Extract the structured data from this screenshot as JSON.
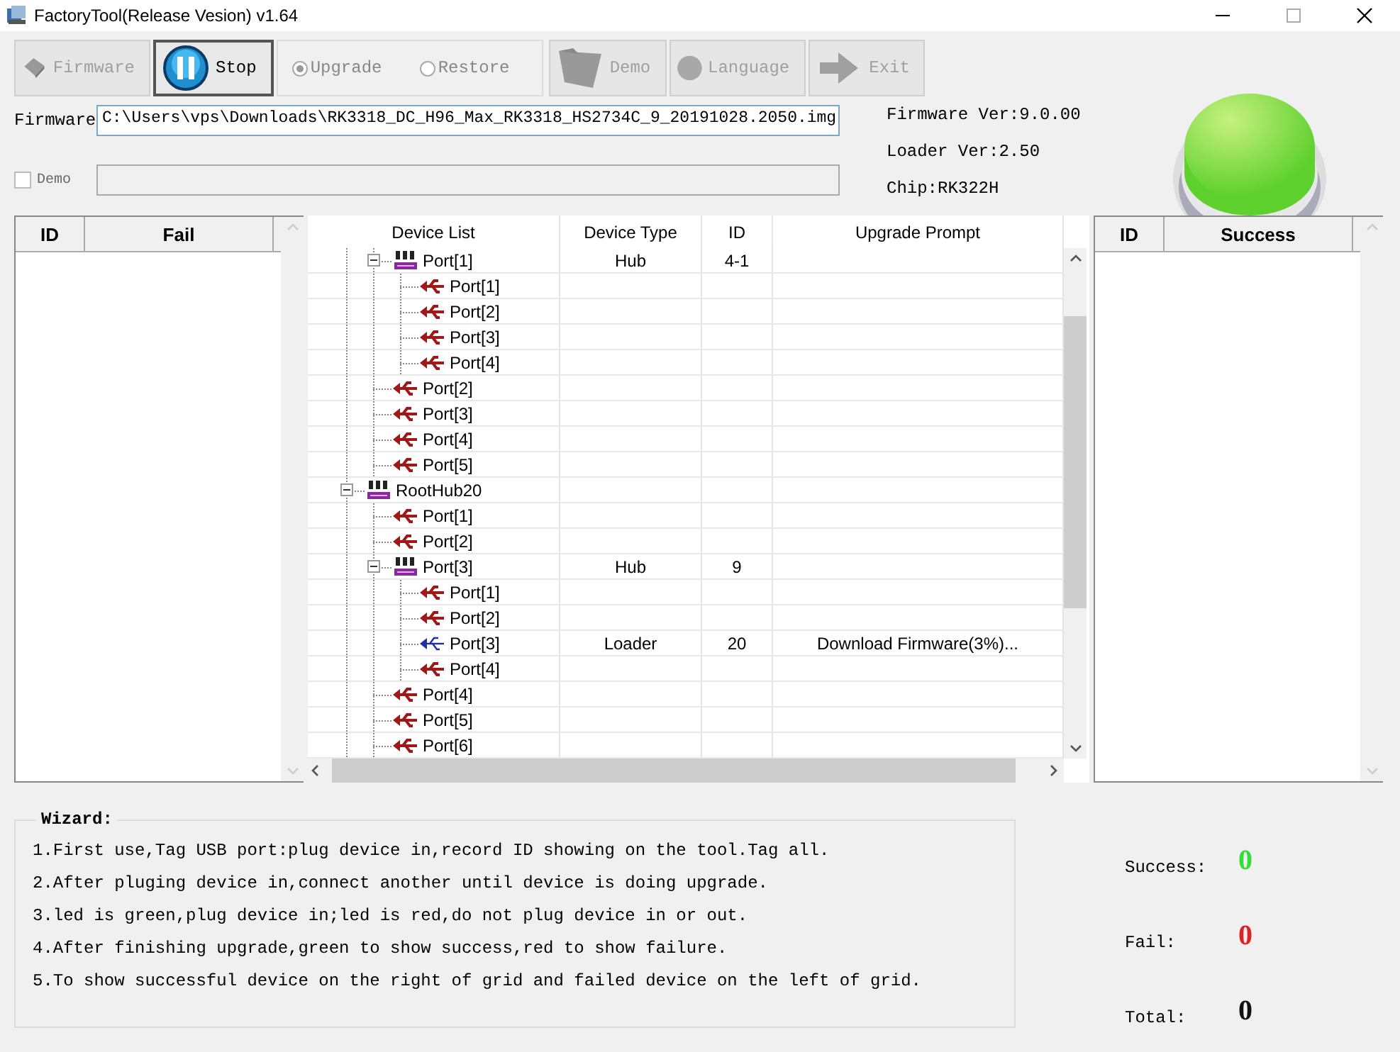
{
  "window": {
    "title": "FactoryTool(Release Vesion) v1.64"
  },
  "toolbar": {
    "buttons": [
      {
        "kind": "firmware",
        "label": "Firmware",
        "disabled": true,
        "pressed": false
      },
      {
        "kind": "stop",
        "label": "Stop",
        "disabled": false,
        "pressed": true
      }
    ],
    "radios": [
      {
        "label": "Upgrade",
        "selected": true,
        "disabled": true
      },
      {
        "label": "Restore",
        "selected": false,
        "disabled": true
      }
    ],
    "buttons_after": [
      {
        "kind": "demo",
        "label": "Demo",
        "disabled": true,
        "pressed": false
      },
      {
        "kind": "language",
        "label": "Language",
        "disabled": true,
        "pressed": false
      },
      {
        "kind": "exit",
        "label": "Exit",
        "disabled": true,
        "pressed": false
      }
    ]
  },
  "firmware": {
    "label": "Firmware",
    "value": "C:\\Users\\vps\\Downloads\\RK3318_DC_H96_Max_RK3318_HS2734C_9_20191028.2050.img"
  },
  "demo": {
    "label": "Demo",
    "checked": false
  },
  "info": [
    "Firmware Ver:9.0.00",
    "Loader Ver:2.50",
    "Chip:RK322H"
  ],
  "led": {
    "color": "#5fd12e"
  },
  "fail_list": {
    "columns": [
      "ID",
      "Fail"
    ]
  },
  "device_grid": {
    "columns": [
      "Device List",
      "Device Type",
      "ID",
      "Upgrade Prompt"
    ],
    "tree": [
      {
        "children": [
          {
            "name": "Port[1]",
            "kind": "hub",
            "expanded": true,
            "type": "Hub",
            "id": "4-1",
            "children": [
              {
                "name": "Port[1]",
                "kind": "port"
              },
              {
                "name": "Port[2]",
                "kind": "port"
              },
              {
                "name": "Port[3]",
                "kind": "port"
              },
              {
                "name": "Port[4]",
                "kind": "port"
              }
            ]
          },
          {
            "name": "Port[2]",
            "kind": "port"
          },
          {
            "name": "Port[3]",
            "kind": "port"
          },
          {
            "name": "Port[4]",
            "kind": "port"
          },
          {
            "name": "Port[5]",
            "kind": "port"
          }
        ]
      },
      {
        "name": "RootHub20",
        "kind": "hub",
        "expanded": true,
        "children": [
          {
            "name": "Port[1]",
            "kind": "port"
          },
          {
            "name": "Port[2]",
            "kind": "port"
          },
          {
            "name": "Port[3]",
            "kind": "hub",
            "expanded": true,
            "type": "Hub",
            "id": "9",
            "children": [
              {
                "name": "Port[1]",
                "kind": "port"
              },
              {
                "name": "Port[2]",
                "kind": "port"
              },
              {
                "name": "Port[3]",
                "kind": "device",
                "type": "Loader",
                "id": "20",
                "prompt": "Download Firmware(3%)..."
              },
              {
                "name": "Port[4]",
                "kind": "port"
              }
            ]
          },
          {
            "name": "Port[4]",
            "kind": "port"
          },
          {
            "name": "Port[5]",
            "kind": "port"
          },
          {
            "name": "Port[6]",
            "kind": "port"
          }
        ]
      }
    ]
  },
  "success_list": {
    "columns": [
      "ID",
      "Success"
    ]
  },
  "wizard": {
    "title": "Wizard:",
    "lines": [
      "1.First use,Tag USB port:plug device in,record ID showing on the tool.Tag all.",
      "2.After pluging device in,connect another until device is doing upgrade.",
      "3.led is green,plug device in;led is red,do not plug device in or out.",
      "4.After finishing upgrade,green to show success,red to show failure.",
      "5.To show successful device on the right of grid and failed device on the left of grid."
    ]
  },
  "stats": [
    {
      "label": "Success:",
      "value": "0",
      "color": "#33dd33"
    },
    {
      "label": "Fail:",
      "value": "0",
      "color": "#dd2222"
    },
    {
      "label": "Total:",
      "value": "0",
      "color": "#111111"
    }
  ]
}
